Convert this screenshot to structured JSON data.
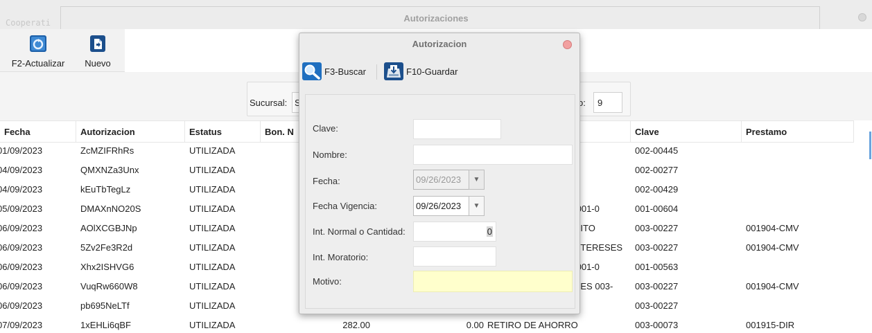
{
  "background_window": {
    "title": "Autorizaciones",
    "app_name_fragment": "Cooperati"
  },
  "toolbar": {
    "refresh_label": "F2-Actualizar",
    "new_label": "Nuevo"
  },
  "filters": {
    "sucursal_label": "Sucursal:",
    "sucursal_value": "S",
    "right_label_fragment": "o:",
    "right_value": "9"
  },
  "table": {
    "headers": [
      "Fecha",
      "Autorizacion",
      "Estatus",
      "Bon. N",
      "",
      "",
      "Clave",
      "Prestamo"
    ],
    "rows": [
      {
        "fecha": "01/09/2023",
        "autorizacion": "ZcMZIFRhRs",
        "estatus": "UTILIZADA",
        "bon": "",
        "col5": "",
        "concepto": "",
        "clave": "002-00445",
        "prestamo": ""
      },
      {
        "fecha": "04/09/2023",
        "autorizacion": "QMXNZa3Unx",
        "estatus": "UTILIZADA",
        "bon": "",
        "col5": "",
        "concepto": "",
        "clave": "002-00277",
        "prestamo": ""
      },
      {
        "fecha": "04/09/2023",
        "autorizacion": "kEuTbTegLz",
        "estatus": "UTILIZADA",
        "bon": "",
        "col5": "",
        "concepto": "",
        "clave": "002-00429",
        "prestamo": ""
      },
      {
        "fecha": "05/09/2023",
        "autorizacion": "DMAXnNO20S",
        "estatus": "UTILIZADA",
        "bon": "",
        "col5": "",
        "concepto": ".001-0",
        "clave": "001-00604",
        "prestamo": ""
      },
      {
        "fecha": "06/09/2023",
        "autorizacion": "AOlXCGBJNp",
        "estatus": "UTILIZADA",
        "bon": "",
        "col5": "",
        "concepto": "DITO",
        "clave": "003-00227",
        "prestamo": "001904-CMV"
      },
      {
        "fecha": "06/09/2023",
        "autorizacion": "5Zv2Fe3R2d",
        "estatus": "UTILIZADA",
        "bon": "",
        "col5": "",
        "concepto": "NTERESES",
        "clave": "003-00227",
        "prestamo": "001904-CMV"
      },
      {
        "fecha": "06/09/2023",
        "autorizacion": "Xhx2ISHVG6",
        "estatus": "UTILIZADA",
        "bon": "",
        "col5": "",
        "concepto": ".001-0",
        "clave": "001-00563",
        "prestamo": ""
      },
      {
        "fecha": "06/09/2023",
        "autorizacion": "VuqRw660W8",
        "estatus": "UTILIZADA",
        "bon": "",
        "col5": "",
        "concepto": "RES 003-",
        "clave": "003-00227",
        "prestamo": "001904-CMV"
      },
      {
        "fecha": "06/09/2023",
        "autorizacion": "pb695NeLTf",
        "estatus": "UTILIZADA",
        "bon": "",
        "col5": "",
        "concepto": "",
        "clave": "003-00227",
        "prestamo": ""
      },
      {
        "fecha": "07/09/2023",
        "autorizacion": "1xEHLi6qBF",
        "estatus": "UTILIZADA",
        "bon": "282.00",
        "col5": "0.00",
        "concepto": "RETIRO DE AHORRO",
        "clave": "003-00073",
        "prestamo": "001915-DIR"
      }
    ]
  },
  "dialog": {
    "title": "Autorizacion",
    "search_label": "F3-Buscar",
    "save_label": "F10-Guardar",
    "fields": {
      "clave_label": "Clave:",
      "clave_value": "",
      "nombre_label": "Nombre:",
      "nombre_value": "",
      "fecha_label": "Fecha:",
      "fecha_value": "09/26/2023",
      "vigencia_label": "Fecha Vigencia:",
      "vigencia_value": "09/26/2023",
      "interes_label": "Int. Normal o Cantidad:",
      "interes_value": "0",
      "moratorio_label": "Int. Moratorio:",
      "moratorio_value": "",
      "motivo_label": "Motivo:",
      "motivo_value": ""
    }
  },
  "colors": {
    "motivo_bg": "#ffffcc",
    "close_button": "#f2a0a0",
    "icon_blue": "#1f6fc0"
  }
}
